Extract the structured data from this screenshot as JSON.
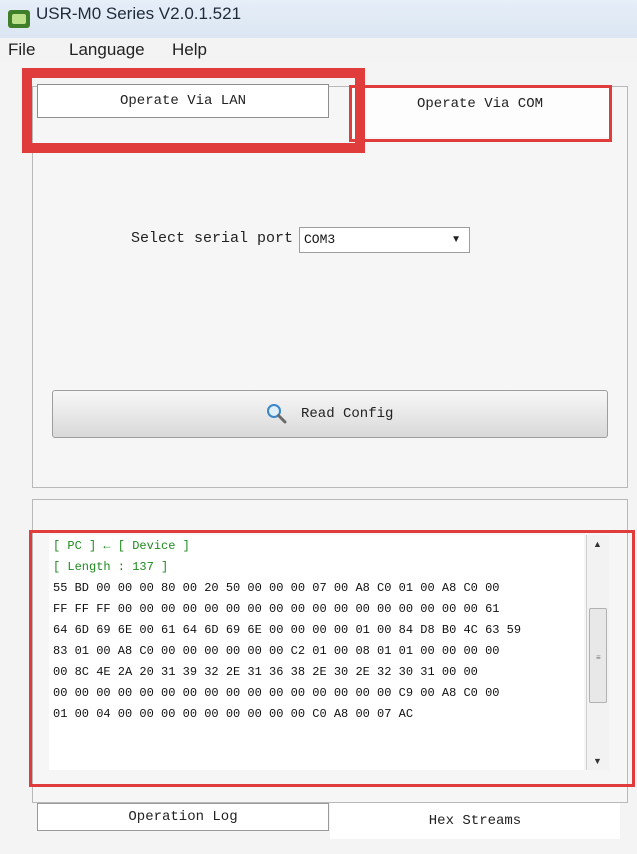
{
  "window": {
    "title": "USR-M0 Series V2.0.1.521"
  },
  "menu": {
    "file": "File",
    "language": "Language",
    "help": "Help"
  },
  "tabs": {
    "lan": "Operate Via LAN",
    "com": "Operate Via COM"
  },
  "com": {
    "label": "Select serial port",
    "selected": "COM3",
    "read_button": "Read Config"
  },
  "stream": {
    "lines": [
      "[ PC ] ← [ Device ]",
      "[ Length : 137 ]",
      "55 BD 00 00 00 80 00 20 50 00 00 00 07 00 A8 C0 01 00 A8 C0 00",
      "FF FF FF 00 00 00 00 00 00 00 00 00 00 00 00 00 00 00 00 00 61",
      "64 6D 69 6E 00 61 64 6D 69 6E 00 00 00 00 01 00 84 D8 B0 4C 63 59",
      "83 01 00 A8 C0 00 00 00 00 00 00 C2 01 00 08 01 01 00 00 00 00",
      "00 8C 4E 2A 20 31 39 32 2E 31 36 38 2E 30 2E 32 30 31 00 00",
      "00 00 00 00 00 00 00 00 00 00 00 00 00 00 00 00 C9 00 A8 C0 00",
      "01 00 04 00 00 00 00 00 00 00 00 00 C0 A8 00 07 AC"
    ]
  },
  "bottom_tabs": {
    "log": "Operation Log",
    "hex": "Hex Streams"
  },
  "colors": {
    "highlight": "#e03c3c",
    "green_text": "#1f8a1f"
  }
}
